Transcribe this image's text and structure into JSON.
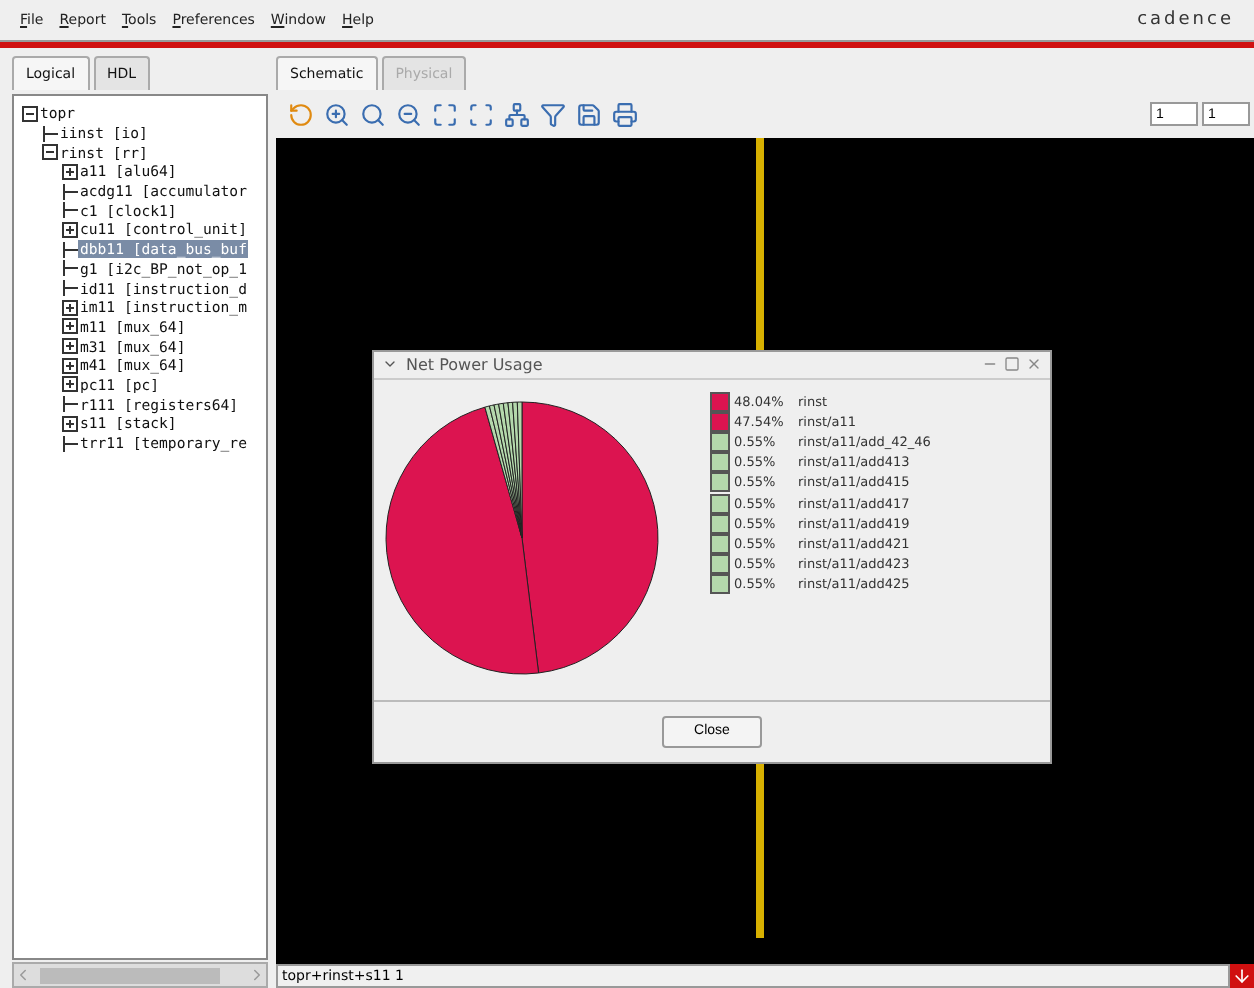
{
  "menu": [
    {
      "label": "File"
    },
    {
      "label": "Report"
    },
    {
      "label": "Tools"
    },
    {
      "label": "Preferences"
    },
    {
      "label": "Window"
    },
    {
      "label": "Help"
    }
  ],
  "logo": "cadence",
  "left_tabs": [
    {
      "label": "Logical",
      "selected": true
    },
    {
      "label": "HDL",
      "selected": false
    }
  ],
  "tree": [
    {
      "label": "topr",
      "kind": "branch",
      "expanded": true,
      "selected": false,
      "children": [
        {
          "label": "iinst [io]",
          "kind": "leaf",
          "selected": false
        },
        {
          "label": "rinst [rr]",
          "kind": "branch",
          "expanded": true,
          "selected": false,
          "children": [
            {
              "label": "a11 [alu64]",
              "kind": "branch",
              "expanded": false,
              "selected": false
            },
            {
              "label": "acdg11 [accumulator",
              "kind": "leaf",
              "selected": false
            },
            {
              "label": "c1 [clock1]",
              "kind": "leaf",
              "selected": false
            },
            {
              "label": "cu11 [control_unit]",
              "kind": "branch",
              "expanded": false,
              "selected": false
            },
            {
              "label": "dbb11 [data_bus_buf",
              "kind": "leaf",
              "selected": true
            },
            {
              "label": "g1 [i2c_BP_not_op_1",
              "kind": "leaf",
              "selected": false
            },
            {
              "label": "id11 [instruction_d",
              "kind": "leaf",
              "selected": false
            },
            {
              "label": "im11 [instruction_m",
              "kind": "branch",
              "expanded": false,
              "selected": false
            },
            {
              "label": "m11 [mux_64]",
              "kind": "branch",
              "expanded": false,
              "selected": false
            },
            {
              "label": "m31 [mux_64]",
              "kind": "branch",
              "expanded": false,
              "selected": false
            },
            {
              "label": "m41 [mux_64]",
              "kind": "branch",
              "expanded": false,
              "selected": false
            },
            {
              "label": "pc11 [pc]",
              "kind": "branch",
              "expanded": false,
              "selected": false
            },
            {
              "label": "r111 [registers64]",
              "kind": "leaf",
              "selected": false
            },
            {
              "label": "s11 [stack]",
              "kind": "branch",
              "expanded": false,
              "selected": false
            },
            {
              "label": "trr11 [temporary_re",
              "kind": "leaf",
              "selected": false
            }
          ]
        }
      ]
    }
  ],
  "right_tabs": [
    {
      "label": "Schematic",
      "selected": true,
      "disabled": false
    },
    {
      "label": "Physical",
      "selected": false,
      "disabled": true
    }
  ],
  "page_fields": [
    {
      "value": "1"
    },
    {
      "value": "1"
    }
  ],
  "dialog": {
    "title": "Net Power Usage",
    "slices": [
      {
        "color": "#dc1450"
      },
      {
        "color": "#dc1450"
      },
      {
        "color": "#b4d8ac"
      },
      {
        "color": "#b4d8ac"
      },
      {
        "color": "#b4d8ac"
      },
      {
        "color": "#b4d8ac"
      },
      {
        "color": "#b4d8ac"
      },
      {
        "color": "#b4d8ac"
      },
      {
        "color": "#b4d8ac"
      },
      {
        "color": "#b4d8ac"
      }
    ],
    "chart_data": {
      "type": "pie",
      "categories": [
        "rinst",
        "rinst/a11",
        "rinst/a11/add_42_46",
        "rinst/a11/add413",
        "rinst/a11/add415",
        "rinst/a11/add417",
        "rinst/a11/add419",
        "rinst/a11/add421",
        "rinst/a11/add423",
        "rinst/a11/add425"
      ],
      "values": [
        48.04,
        47.54,
        0.55,
        0.55,
        0.55,
        0.55,
        0.55,
        0.55,
        0.55,
        0.55
      ],
      "value_labels": [
        "48.04%",
        "47.54%",
        "0.55%",
        "0.55%",
        "0.55%",
        "0.55%",
        "0.55%",
        "0.55%",
        "0.55%",
        "0.55%"
      ]
    },
    "close_button": "Close"
  },
  "status": "topr+rinst+s11 1"
}
